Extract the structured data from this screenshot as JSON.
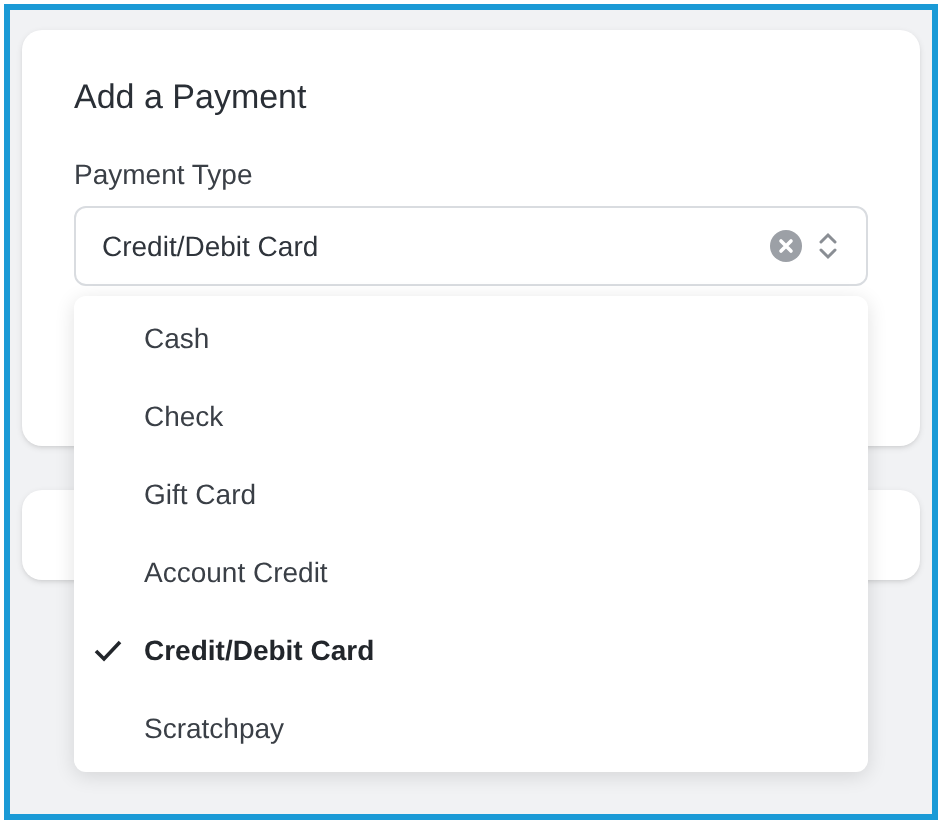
{
  "card": {
    "title": "Add a Payment"
  },
  "payment_type": {
    "label": "Payment Type",
    "value": "Credit/Debit Card",
    "open": true
  },
  "options": [
    {
      "label": "Cash",
      "selected": false
    },
    {
      "label": "Check",
      "selected": false
    },
    {
      "label": "Gift Card",
      "selected": false
    },
    {
      "label": "Account Credit",
      "selected": false
    },
    {
      "label": "Credit/Debit Card",
      "selected": true
    },
    {
      "label": "Scratchpay",
      "selected": false
    }
  ]
}
